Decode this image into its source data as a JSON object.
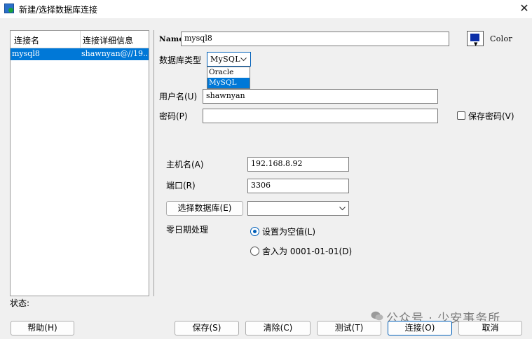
{
  "window": {
    "title": "新建/选择数据库连接",
    "close_glyph": "✕"
  },
  "connections": {
    "headers": [
      "连接名",
      "连接详细信息"
    ],
    "rows": [
      {
        "name": "mysql8",
        "details": "shawnyan@//19..."
      }
    ]
  },
  "form": {
    "name_label": "Name",
    "name_value": "mysql8",
    "color_label": "Color",
    "color_value": "#0b2fa8",
    "db_type_label": "数据库类型",
    "db_type_value": "MySQL",
    "db_type_options": [
      "Oracle",
      "MySQL"
    ],
    "username_label": "用户名(U)",
    "username_value": "shawnyan",
    "password_label": "密码(P)",
    "password_value": "",
    "save_password_label": "保存密码(V)",
    "host_label": "主机名(A)",
    "host_value": "192.168.8.92",
    "port_label": "端口(R)",
    "port_value": "3306",
    "select_db_button": "选择数据库(E)",
    "select_db_value": "",
    "zero_date_label": "零日期处理",
    "zero_date_options": [
      "设置为空值(L)",
      "舍入为 0001-01-01(D)"
    ],
    "zero_date_selected": 0
  },
  "status_label": "状态:",
  "buttons": {
    "help": "帮助(H)",
    "save": "保存(S)",
    "clear": "清除(C)",
    "test": "测试(T)",
    "connect": "连接(O)",
    "cancel": "取消"
  },
  "watermark": "公众号 · 少安事务所",
  "accent": "#0078d7"
}
